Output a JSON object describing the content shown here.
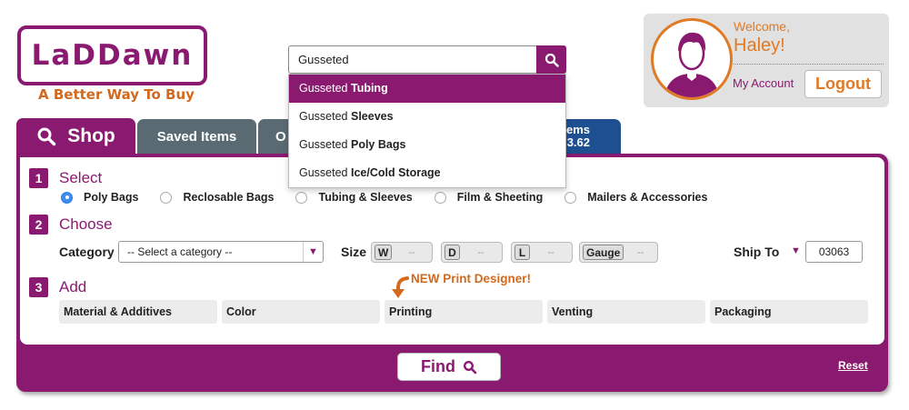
{
  "logo": {
    "text": "LaDDawn",
    "tagline": "A Better Way To Buy"
  },
  "search": {
    "value": "Gusseted",
    "suggestions": [
      {
        "prefix": "Gusseted ",
        "bold": "Tubing"
      },
      {
        "prefix": "Gusseted ",
        "bold": "Sleeves"
      },
      {
        "prefix": "Gusseted ",
        "bold": "Poly Bags"
      },
      {
        "prefix": "Gusseted ",
        "bold": "Ice/Cold Storage"
      }
    ]
  },
  "account": {
    "welcome": "Welcome,",
    "name": "Haley!",
    "my_account": "My Account",
    "logout": "Logout"
  },
  "tabs": {
    "shop": "Shop",
    "saved": "Saved Items",
    "orders_partial": "O",
    "items_line1": "ems",
    "items_line2": "3.62"
  },
  "steps": {
    "select": {
      "num": "1",
      "title": "Select"
    },
    "choose": {
      "num": "2",
      "title": "Choose"
    },
    "add": {
      "num": "3",
      "title": "Add"
    }
  },
  "product_types": [
    "Poly Bags",
    "Reclosable Bags",
    "Tubing & Sleeves",
    "Film & Sheeting",
    "Mailers & Accessories"
  ],
  "selected_product_type": "Poly Bags",
  "category": {
    "label": "Category",
    "placeholder": "-- Select a category --"
  },
  "size": {
    "label": "Size",
    "fields": [
      {
        "key": "W",
        "value": "--"
      },
      {
        "key": "D",
        "value": "--"
      },
      {
        "key": "L",
        "value": "--"
      },
      {
        "key": "Gauge",
        "value": "--"
      }
    ]
  },
  "ship_to": {
    "label": "Ship To",
    "zip": "03063"
  },
  "new_print_designer": "NEW Print Designer!",
  "add_options": [
    "Material & Additives",
    "Color",
    "Printing",
    "Venting",
    "Packaging"
  ],
  "find_label": "Find",
  "reset_label": "Reset",
  "colors": {
    "brand": "#8a1a70",
    "accent": "#e07a25",
    "tab_gray": "#5a6a73",
    "tab_blue": "#1d4f91"
  }
}
